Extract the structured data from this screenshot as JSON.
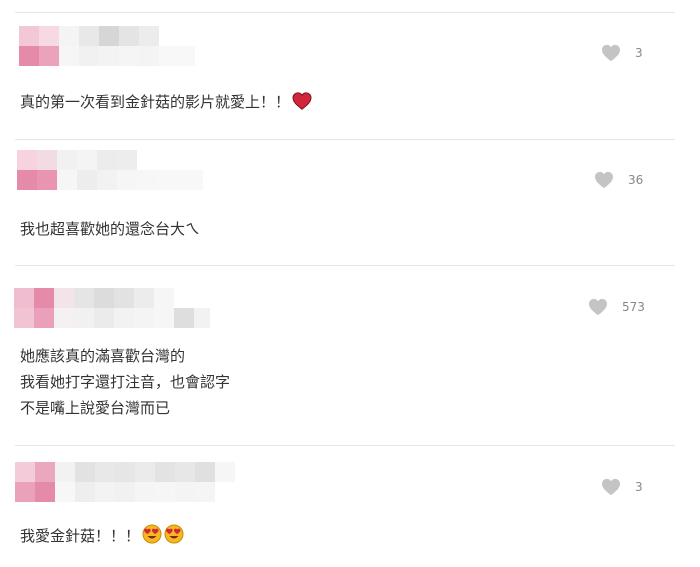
{
  "comments": [
    {
      "text_lines": [
        "真的第一次看到金針菇的影片就愛上！！"
      ],
      "emojis": [
        "red-heart"
      ],
      "likes": "3"
    },
    {
      "text_lines": [
        "我也超喜歡她的還念台大ㄟ"
      ],
      "emojis": [],
      "likes": "36"
    },
    {
      "text_lines": [
        "她應該真的滿喜歡台灣的",
        "我看她打字還打注音，也會認字",
        "不是嘴上說愛台灣而已"
      ],
      "emojis": [],
      "likes": "573"
    },
    {
      "text_lines": [
        "我愛金針菇！！！"
      ],
      "emojis": [
        "heart-eyes",
        "heart-eyes"
      ],
      "likes": "3"
    }
  ],
  "colors": {
    "like_heart": "#c4c4c4",
    "emoji_heart": "#d0253a",
    "emoji_face": "#f6b81e",
    "avatar_pink": "#e58aa8",
    "avatar_light": "#f2c4d3"
  }
}
